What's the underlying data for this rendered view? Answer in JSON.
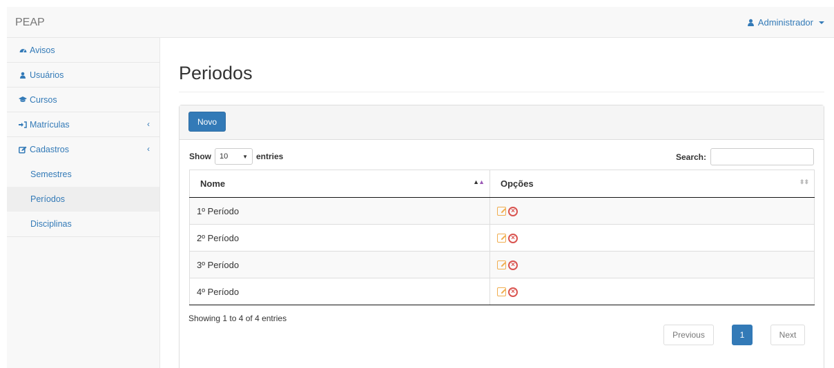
{
  "navbar": {
    "brand": "PEAP",
    "user": "Administrador"
  },
  "sidebar": {
    "items": [
      {
        "label": "Avisos",
        "icon": "dashboard-icon"
      },
      {
        "label": "Usuários",
        "icon": "user-icon"
      },
      {
        "label": "Cursos",
        "icon": "graduation-cap-icon"
      },
      {
        "label": "Matrículas",
        "icon": "sign-in-icon"
      },
      {
        "label": "Cadastros",
        "icon": "edit-icon"
      }
    ],
    "subitems": [
      "Semestres",
      "Períodos",
      "Disciplinas"
    ],
    "active": "Períodos"
  },
  "page": {
    "title": "Periodos"
  },
  "panel": {
    "new_button": "Novo"
  },
  "table_controls": {
    "show_label": "Show",
    "page_size": "10",
    "entries_label": "entries",
    "search_label": "Search:",
    "search_value": ""
  },
  "table": {
    "headers": [
      "Nome",
      "Opções"
    ],
    "rows": [
      "1º Período",
      "2º Período",
      "3º Período",
      "4º Período"
    ]
  },
  "footer": {
    "info": "Showing 1 to 4 of 4 entries",
    "previous": "Previous",
    "page": "1",
    "next": "Next"
  },
  "colors": {
    "link": "#337ab7",
    "edit": "#f0ad4e",
    "delete": "#d9534f"
  }
}
